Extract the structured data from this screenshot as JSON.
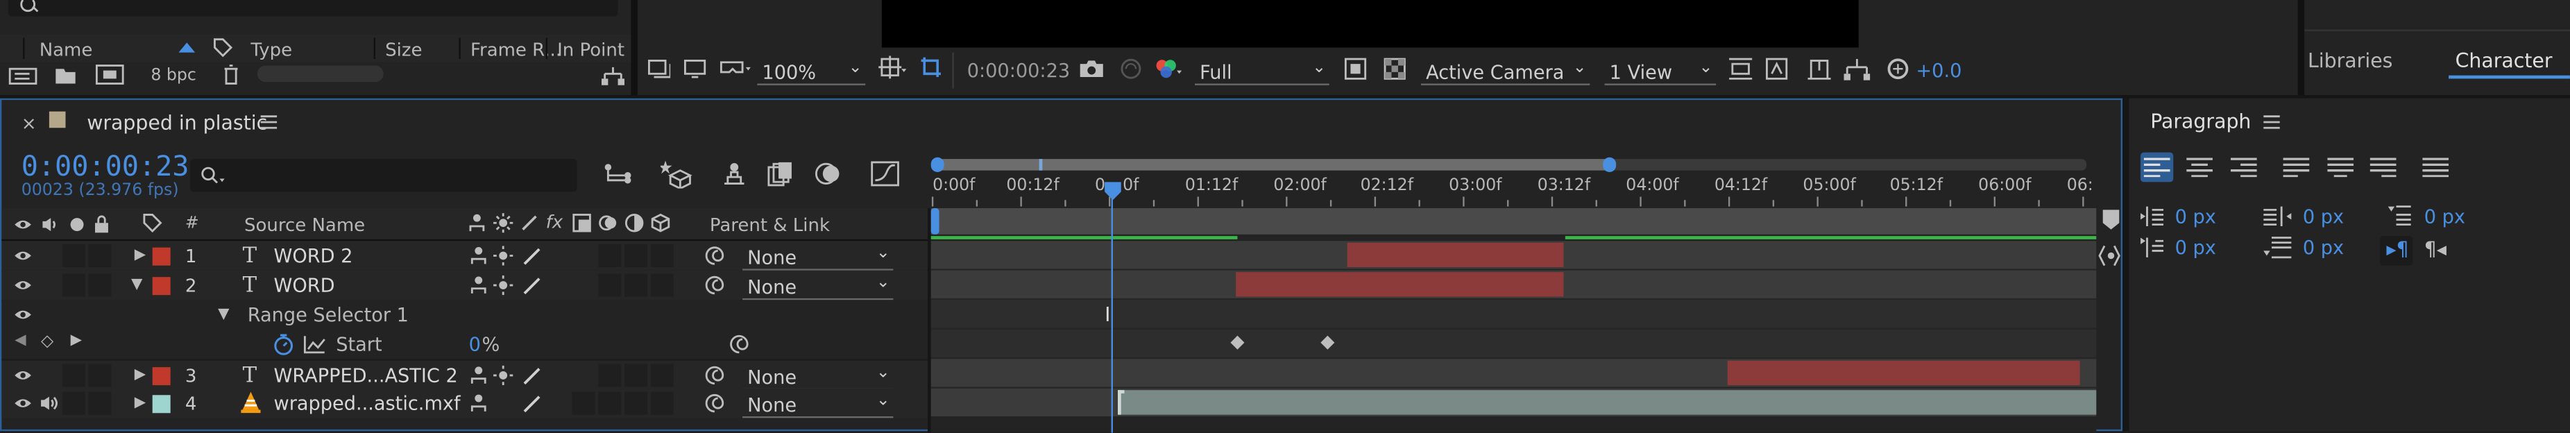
{
  "project": {
    "columns": [
      "Name",
      "Type",
      "Size",
      "Frame R...",
      "In Point"
    ],
    "bpc": "8 bpc"
  },
  "viewer": {
    "zoom": "100%",
    "timecode": "0:00:00:23",
    "resolution": "Full",
    "camera": "Active Camera",
    "views": "1 View",
    "exposure": "+0.0"
  },
  "panels": {
    "libraries": "Libraries",
    "character": "Character",
    "paragraph": "Paragraph"
  },
  "comp": {
    "name": "wrapped in plastic",
    "timecode": "0:00:00:23",
    "frames": "00023 (23.976 fps)"
  },
  "layer_headers": {
    "num": "#",
    "source": "Source Name",
    "parent": "Parent & Link"
  },
  "layers": [
    {
      "num": "1",
      "name": "WORD 2",
      "type": "T",
      "parent": "None",
      "color": "#c0392b"
    },
    {
      "num": "2",
      "name": "WORD",
      "type": "T",
      "parent": "None",
      "color": "#c0392b"
    },
    {
      "num": "3",
      "name": "WRAPPED...ASTIC 2",
      "type": "T",
      "parent": "None",
      "color": "#c0392b"
    },
    {
      "num": "4",
      "name": "wrapped...astic.mxf",
      "type": "footage",
      "parent": "None",
      "color": "#9fd5cf"
    }
  ],
  "range_selector": {
    "label": "Range Selector 1",
    "property": "Start",
    "value": "0",
    "unit": "%"
  },
  "ruler": [
    "0:00f",
    "00:12f",
    "0",
    "0f",
    "01:12f",
    "02:00f",
    "02:12f",
    "03:00f",
    "03:12f",
    "04:00f",
    "04:12f",
    "05:00f",
    "05:12f",
    "06:00f",
    "06:"
  ],
  "paragraph": {
    "indent_left": "0 px",
    "indent_right": "0 px",
    "space_before": "0 px",
    "indent_first": "0 px",
    "space_after": "0 px"
  },
  "colors": {
    "accent": "#4a90e2",
    "layer_bar_red": "#8c3a3a",
    "footage_bar": "#7a8b87",
    "work_area_green": "#3cb54a"
  }
}
